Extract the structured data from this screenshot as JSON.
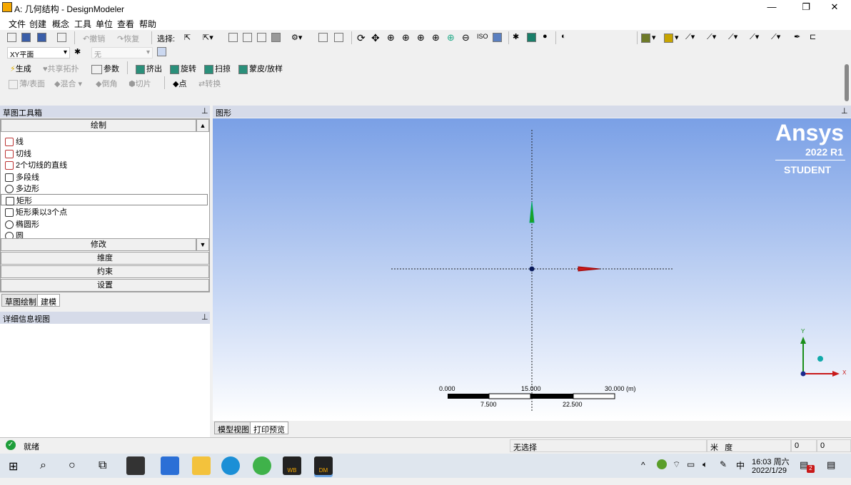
{
  "window": {
    "title": "A: 几何结构 - DesignModeler",
    "minimize": "—",
    "restore": "❐",
    "close": "✕"
  },
  "menu": [
    "文件",
    "创建",
    "概念",
    "工具",
    "单位",
    "查看",
    "帮助"
  ],
  "toolbar1": {
    "undo": "撤销",
    "redo": "恢复",
    "select_label": "选择:"
  },
  "toolbar2": {
    "plane": "XY平面",
    "sketch": "无"
  },
  "toolbar3": {
    "generate": "生成",
    "share_topology": "共享拓扑",
    "parameters": "参数",
    "extrude": "挤出",
    "revolve": "旋转",
    "sweep": "扫掠",
    "skin_loft": "蒙皮/放样"
  },
  "toolbar4": {
    "thin_surface": "薄/表面",
    "blend": "混合",
    "chamfer": "倒角",
    "slice": "切片",
    "point": "点",
    "conversion": "转换"
  },
  "sketch_panel": {
    "title": "草图工具箱",
    "pin": "ᵖ",
    "draw_group": "绘制",
    "items": [
      "线",
      "切线",
      "2个切线的直线",
      "多段线",
      "多边形",
      "矩形",
      "矩形乘以3个点",
      "椭圆形",
      "圆"
    ],
    "modify": "修改",
    "dimensions": "维度",
    "constraints": "约束",
    "settings": "设置",
    "tab_sketching": "草图绘制",
    "tab_modeling": "建模"
  },
  "details_panel": {
    "title": "详细信息视图"
  },
  "graphics": {
    "title": "图形",
    "brand": "Ansys",
    "version": "2022 R1",
    "edition": "STUDENT",
    "scale_labels_top": [
      "0.000",
      "15.000",
      "30.000 (m)"
    ],
    "scale_labels_bottom": [
      "7.500",
      "22.500"
    ],
    "triad_x": "X",
    "triad_y": "Y",
    "tab_model": "模型视图",
    "tab_print": "打印预览"
  },
  "status": {
    "ready": "就绪",
    "selection": "无选择",
    "unit1": "米",
    "unit2": "度",
    "v1": "0",
    "v2": "0"
  },
  "taskbar": {
    "time": "16:03 周六",
    "date": "2022/1/29",
    "ime": "中",
    "notif_count": "2",
    "wb": "WB",
    "dm": "DM"
  }
}
